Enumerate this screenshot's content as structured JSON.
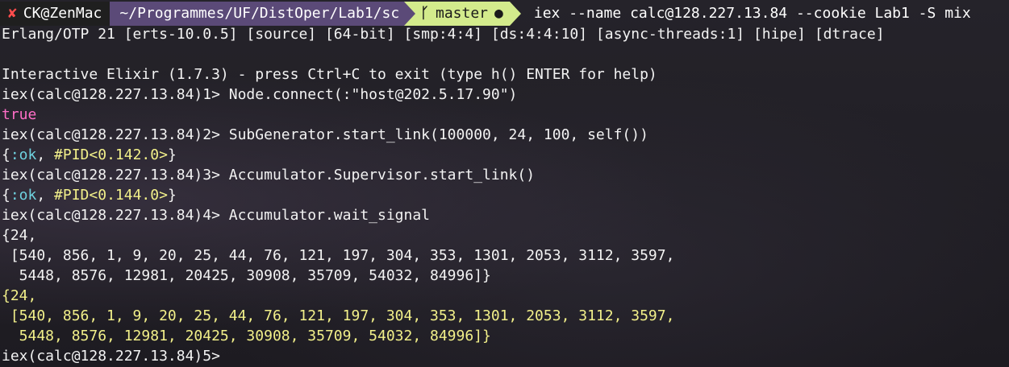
{
  "prompt": {
    "host": "CK@ZenMac",
    "path": "~/Programmes/UF/DistOper/Lab1/sc",
    "branch": "master",
    "command": "iex --name calc@128.227.13.84 --cookie Lab1 -S mix"
  },
  "lines": {
    "banner": "Erlang/OTP 21 [erts-10.0.5] [source] [64-bit] [smp:4:4] [ds:4:4:10] [async-threads:1] [hipe] [dtrace]",
    "blank": "",
    "interactive": "Interactive Elixir (1.7.3) - press Ctrl+C to exit (type h() ENTER for help)",
    "in1": "iex(calc@128.227.13.84)1> Node.connect(:\"host@202.5.17.90\")",
    "out1": "true",
    "in2": "iex(calc@128.227.13.84)2> SubGenerator.start_link(100000, 24, 100, self())",
    "out2_open": "{",
    "out2_atom": ":ok",
    "out2_sep": ", ",
    "out2_pid": "#PID<0.142.0>",
    "out2_close": "}",
    "in3": "iex(calc@128.227.13.84)3> Accumulator.Supervisor.start_link()",
    "out3_open": "{",
    "out3_atom": ":ok",
    "out3_sep": ", ",
    "out3_pid": "#PID<0.144.0>",
    "out3_close": "}",
    "in4": "iex(calc@128.227.13.84)4> Accumulator.wait_signal",
    "r1a": "{24,",
    "r1b": " [540, 856, 1, 9, 20, 25, 44, 76, 121, 197, 304, 353, 1301, 2053, 3112, 3597,",
    "r1c": "  5448, 8576, 12981, 20425, 30908, 35709, 54032, 84996]}",
    "r2a": "{24,",
    "r2b": " [540, 856, 1, 9, 20, 25, 44, 76, 121, 197, 304, 353, 1301, 2053, 3112, 3597,",
    "r2c": "  5448, 8576, 12981, 20425, 30908, 35709, 54032, 84996]}",
    "in5": "iex(calc@128.227.13.84)5> "
  }
}
